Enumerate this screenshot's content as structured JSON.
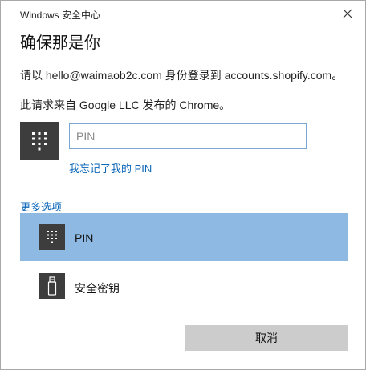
{
  "window": {
    "title": "Windows 安全中心"
  },
  "dialog": {
    "heading": "确保那是你",
    "line1": "请以 hello@waimaob2c.com 身份登录到 accounts.shopify.com。",
    "line2": "此请求来自 Google LLC 发布的 Chrome。"
  },
  "pin_entry": {
    "placeholder": "PIN",
    "value": "",
    "forgot_link": "我忘记了我的 PIN"
  },
  "more_options": {
    "label": "更多选项",
    "items": [
      {
        "label": "PIN",
        "icon": "keypad-icon",
        "selected": true
      },
      {
        "label": "安全密钥",
        "icon": "usb-key-icon",
        "selected": false
      }
    ]
  },
  "buttons": {
    "cancel": "取消"
  },
  "colors": {
    "accent_link": "#0a66b8",
    "selected_bg": "#8db9e2",
    "tile_bg": "#3d3d3d",
    "button_bg": "#cccccc"
  }
}
